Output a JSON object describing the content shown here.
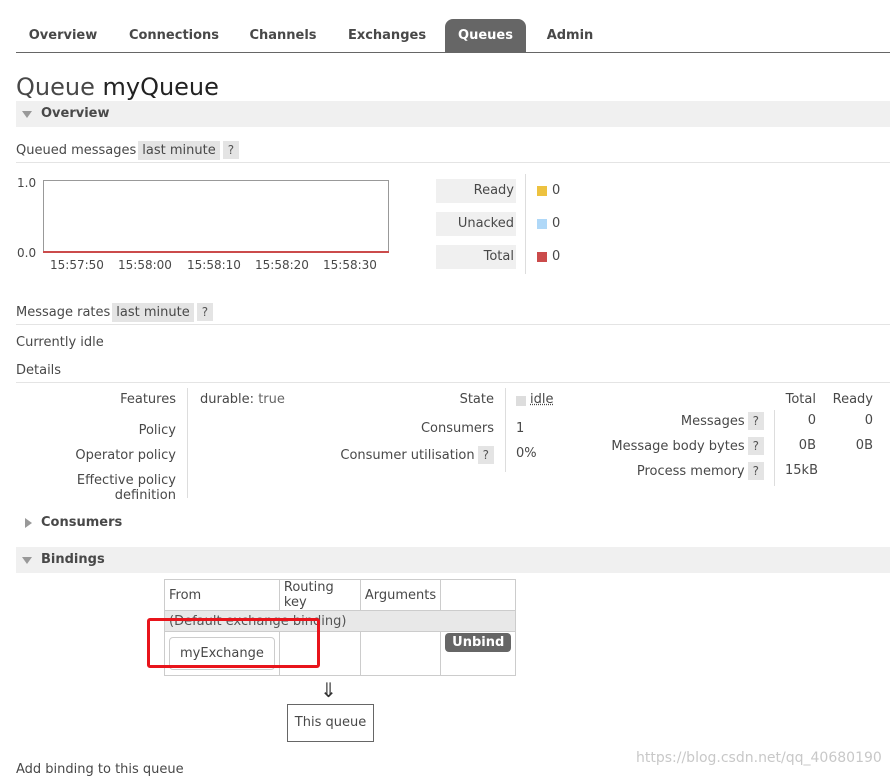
{
  "nav": {
    "tabs": [
      "Overview",
      "Connections",
      "Channels",
      "Exchanges",
      "Queues",
      "Admin"
    ],
    "active": "Queues"
  },
  "title": {
    "prefix": "Queue",
    "name": "myQueue"
  },
  "overview_section": "Overview",
  "queued": {
    "label": "Queued messages",
    "range": "last minute",
    "help": "?",
    "y_ticks": [
      "1.0",
      "0.0"
    ],
    "x_ticks": [
      "15:57:50",
      "15:58:00",
      "15:58:10",
      "15:58:20",
      "15:58:30"
    ],
    "legend": [
      {
        "label": "Ready",
        "value": "0",
        "color": "#edc240"
      },
      {
        "label": "Unacked",
        "value": "0",
        "color": "#afd8f8"
      },
      {
        "label": "Total",
        "value": "0",
        "color": "#cb4b4b"
      }
    ]
  },
  "rates": {
    "label": "Message rates",
    "range": "last minute",
    "help": "?",
    "status": "Currently idle"
  },
  "details": {
    "label": "Details",
    "features_label": "Features",
    "features_key": "durable:",
    "features_val": "true",
    "policy_label": "Policy",
    "operator_policy_label": "Operator policy",
    "effective_policy_label": "Effective policy definition",
    "state_label": "State",
    "state_val": "idle",
    "consumers_label": "Consumers",
    "consumers_val": "1",
    "utilisation_label": "Consumer utilisation",
    "utilisation_val": "0%",
    "help": "?",
    "col_total": "Total",
    "col_ready": "Ready",
    "messages_label": "Messages",
    "messages_total": "0",
    "messages_ready": "0",
    "body_bytes_label": "Message body bytes",
    "body_bytes_total": "0B",
    "body_bytes_ready": "0B",
    "memory_label": "Process memory",
    "memory_total": "15kB"
  },
  "consumers_section": "Consumers",
  "bindings_section": "Bindings",
  "bindings": {
    "headers": [
      "From",
      "Routing key",
      "Arguments"
    ],
    "default_row": "(Default exchange binding)",
    "exchange": "myExchange",
    "unbind": "Unbind",
    "arrow": "⇓",
    "this_queue": "This queue"
  },
  "add_binding": "Add binding to this queue",
  "watermark": "https://blog.csdn.net/qq_40680190"
}
